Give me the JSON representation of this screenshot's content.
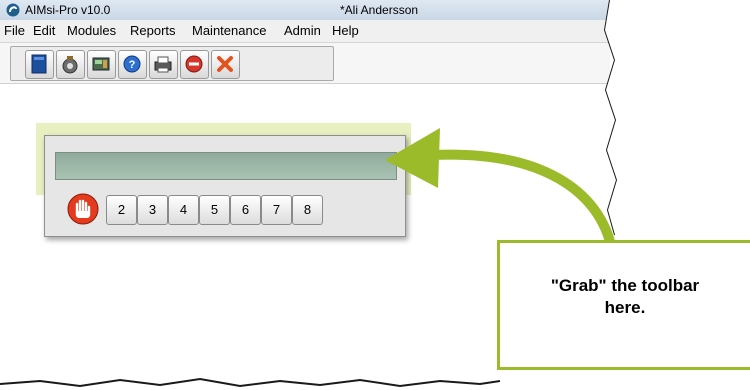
{
  "window": {
    "app_title": "AIMsi-Pro v10.0",
    "doc_title": "*Ali Andersson"
  },
  "menu": {
    "items": [
      "File",
      "Edit",
      "Modules",
      "Reports",
      "Maintenance",
      "Admin",
      "Help"
    ]
  },
  "toolbar": {
    "icons": [
      "new-document-icon",
      "money-bag-icon",
      "register-icon",
      "help-icon",
      "printer-icon",
      "stop-icon",
      "close-icon"
    ]
  },
  "floating_toolbar": {
    "buttons": [
      "2",
      "3",
      "4",
      "5",
      "6",
      "7",
      "8"
    ],
    "first_icon": "hand-stop-icon"
  },
  "callout": {
    "line1": "\"Grab\" the toolbar",
    "line2": "here.",
    "accent_color": "#9bbb2a"
  }
}
